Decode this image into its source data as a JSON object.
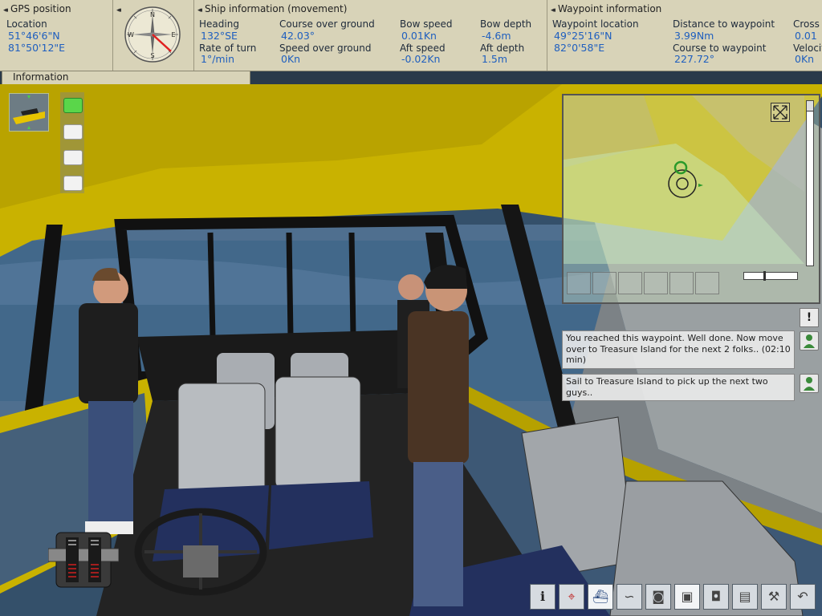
{
  "gps": {
    "title": "GPS position",
    "location_label": "Location",
    "lat": "51°46'6\"N",
    "lon": "81°50'12\"E"
  },
  "ship": {
    "title": "Ship information (movement)",
    "heading_label": "Heading",
    "heading": "132°SE",
    "course_label": "Course over ground",
    "course": "42.03°",
    "bow_speed_label": "Bow speed",
    "bow_speed": "0.01Kn",
    "bow_depth_label": "Bow depth",
    "bow_depth": "-4.6m",
    "rot_label": "Rate of turn",
    "rot": "1°/min",
    "sog_label": "Speed over ground",
    "sog": "0Kn",
    "aft_speed_label": "Aft speed",
    "aft_speed": "-0.02Kn",
    "aft_depth_label": "Aft depth",
    "aft_depth": "1.5m"
  },
  "waypoint": {
    "title": "Waypoint information",
    "loc_label": "Waypoint location",
    "lat": "49°25'16\"N",
    "lon": "82°0'58\"E",
    "dist_label": "Distance to waypoint",
    "dist": "3.99Nm",
    "course_label": "Course to waypoint",
    "course": "227.72°",
    "cross_label": "Cross",
    "cross": "0.01",
    "vel_label": "Velocit",
    "vel": "0Kn"
  },
  "info_tab": "Information",
  "messages": [
    "You reached this waypoint. Well done. Now move over to Treasure Island for the next 2 folks.. (02:10 min)",
    "Sail to Treasure Island to pick up the next two guys.."
  ],
  "alert_glyph": "!",
  "toolbar_icons": [
    "info-icon",
    "map-pin-icon",
    "ship-icon",
    "rope-icon",
    "camera-film-icon",
    "screen-capture-icon",
    "photo-camera-icon",
    "logbook-icon",
    "wrench-icon",
    "undo-icon"
  ],
  "colors": {
    "panel_bg": "#d8d3b8",
    "value_blue": "#1f5fbf",
    "hull_yellow": "#c9b200"
  }
}
